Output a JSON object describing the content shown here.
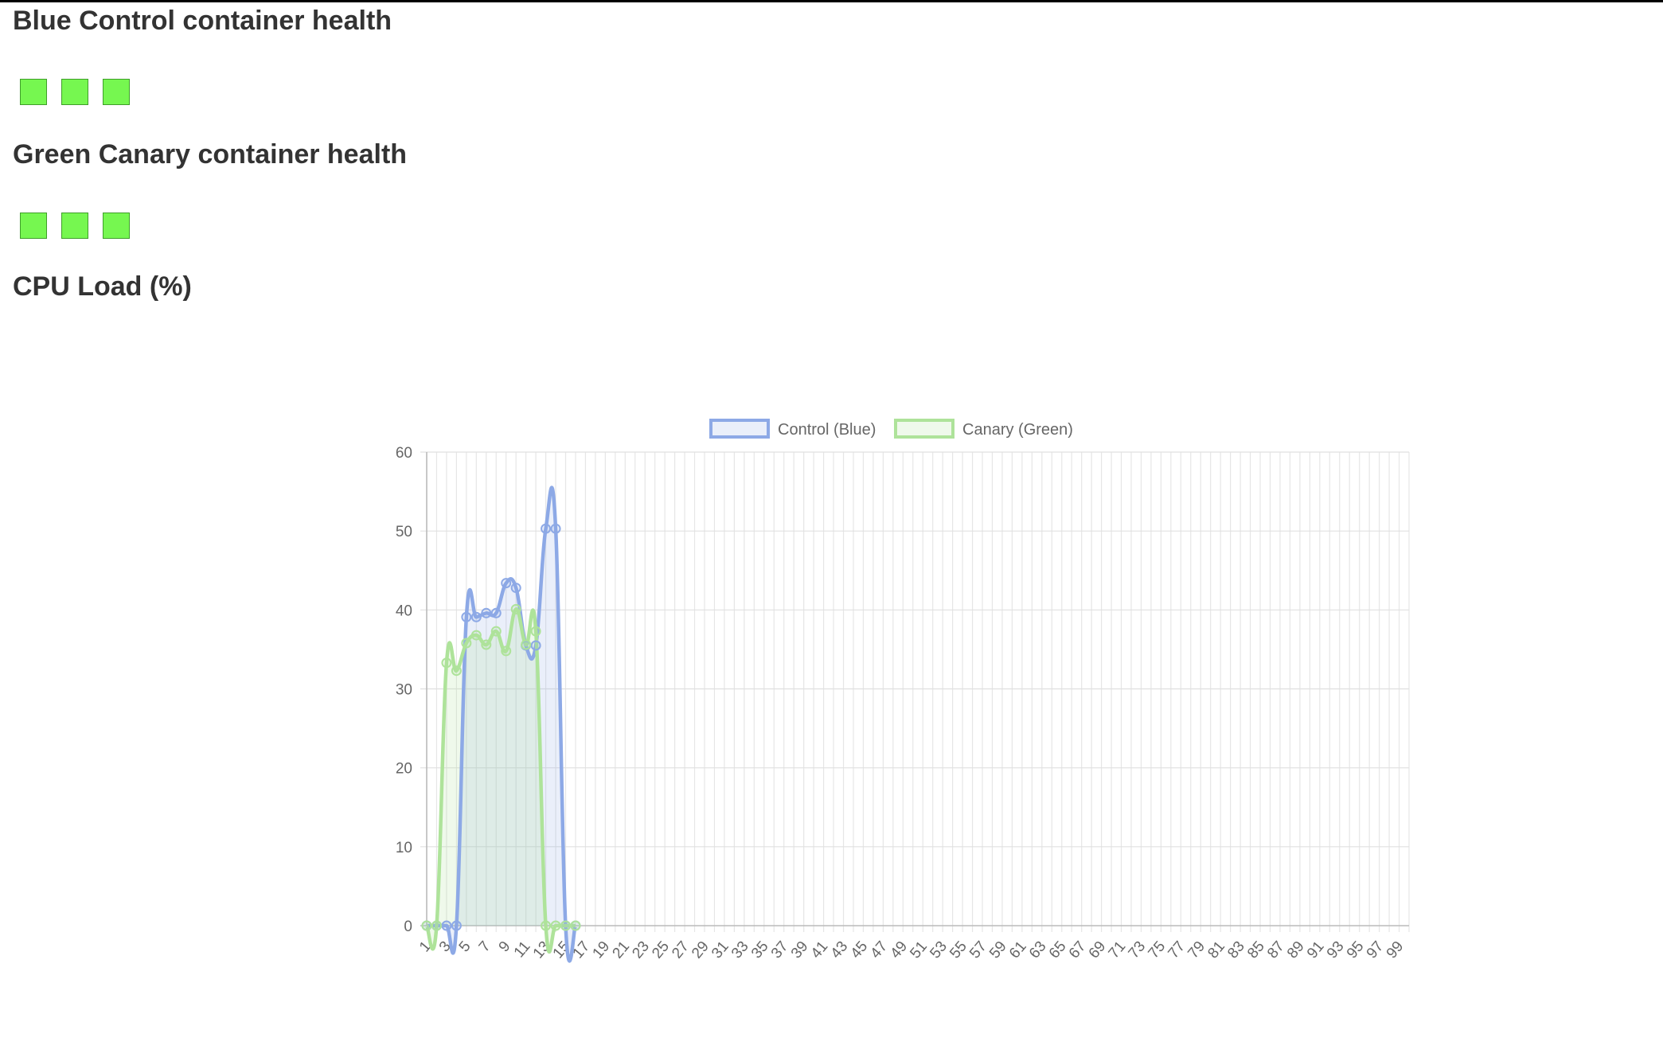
{
  "sections": {
    "blue_title": "Blue Control container health",
    "green_title": "Green Canary container health",
    "cpu_title": "CPU Load (%)"
  },
  "blue_health": [
    {
      "status": "healthy",
      "color": "#76f750"
    },
    {
      "status": "healthy",
      "color": "#76f750"
    },
    {
      "status": "healthy",
      "color": "#76f750"
    }
  ],
  "green_health": [
    {
      "status": "healthy",
      "color": "#76f750"
    },
    {
      "status": "healthy",
      "color": "#76f750"
    },
    {
      "status": "healthy",
      "color": "#76f750"
    }
  ],
  "chart_data": {
    "type": "line",
    "title": "",
    "xlabel": "",
    "ylabel": "",
    "x_range": [
      1,
      100
    ],
    "x_tick_step": 2,
    "ylim": [
      0,
      60
    ],
    "y_ticks": [
      0,
      10,
      20,
      30,
      40,
      50,
      60
    ],
    "grid": true,
    "legend_position": "top-center",
    "series": [
      {
        "name": "Control (Blue)",
        "color": "#8da9e6",
        "fill": "rgba(141,169,230,0.18)",
        "x": [
          1,
          2,
          3,
          4,
          5,
          6,
          7,
          8,
          9,
          10,
          11,
          12,
          13,
          14,
          15,
          16
        ],
        "values": [
          0,
          0,
          0,
          0,
          39.1,
          39.1,
          39.6,
          39.6,
          43.4,
          42.8,
          35.5,
          35.5,
          50.3,
          50.3,
          0,
          0
        ]
      },
      {
        "name": "Canary (Green)",
        "color": "#aee39a",
        "fill": "rgba(174,227,154,0.20)",
        "x": [
          1,
          2,
          3,
          4,
          5,
          6,
          7,
          8,
          9,
          10,
          11,
          12,
          13,
          14,
          15,
          16
        ],
        "values": [
          0,
          0,
          33.3,
          32.3,
          35.8,
          36.8,
          35.6,
          37.3,
          34.8,
          40.1,
          35.6,
          37.3,
          0,
          0,
          0,
          0
        ]
      }
    ]
  }
}
